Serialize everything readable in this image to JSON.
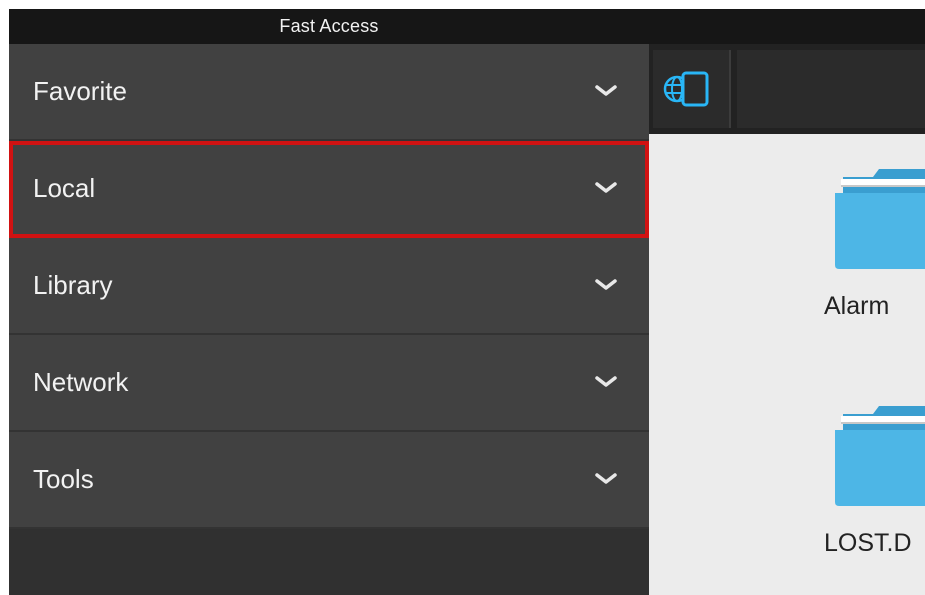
{
  "app": {
    "title": "Fast Access"
  },
  "drawer": {
    "items": [
      {
        "label": "Favorite",
        "icon": "chevron-down-icon",
        "selected": false
      },
      {
        "label": "Local",
        "icon": "chevron-down-icon",
        "selected": true
      },
      {
        "label": "Library",
        "icon": "chevron-down-icon",
        "selected": false
      },
      {
        "label": "Network",
        "icon": "chevron-down-icon",
        "selected": false
      },
      {
        "label": "Tools",
        "icon": "chevron-down-icon",
        "selected": false
      }
    ]
  },
  "toolbar": {
    "storage_icon": "globe-device-icon"
  },
  "files": [
    {
      "name": "Alarm",
      "icon": "folder-icon"
    },
    {
      "name": "LOST.D",
      "icon": "folder-icon"
    }
  ],
  "colors": {
    "title_bar": "#161616",
    "drawer_bg": "#414141",
    "highlight": "#d01212",
    "folder": "#4db6e6",
    "accent_icon": "#29b6f6"
  }
}
